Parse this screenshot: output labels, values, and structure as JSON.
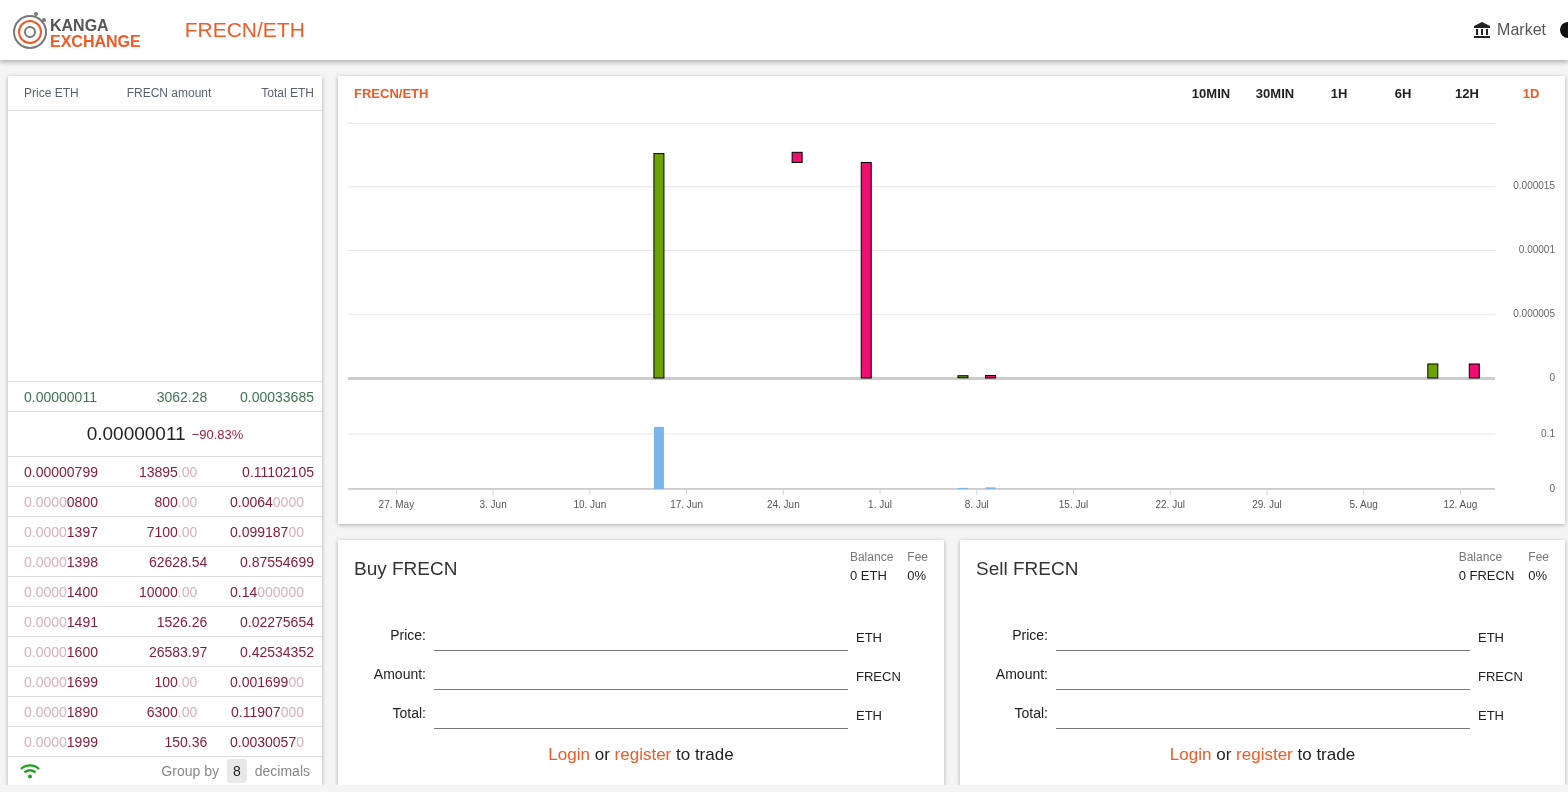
{
  "header": {
    "logo_top": "KANGA",
    "logo_bottom": "EXCHANGE",
    "pair": "FRECN/ETH",
    "market": "Market"
  },
  "order_book": {
    "columns": [
      "Price ETH",
      "FRECN amount",
      "Total ETH"
    ],
    "rows_above": [
      {
        "color": "#3d7550",
        "cells": [
          [
            {
              "text": "0.00000011",
              "faded": false
            }
          ],
          [
            {
              "text": "3062.28",
              "faded": false
            }
          ],
          [
            {
              "text": "0.00033685",
              "faded": false
            }
          ]
        ]
      }
    ],
    "last_price": "0.00000011",
    "change": "−90.83%",
    "rows_below": [
      {
        "color": "#8a1c3c",
        "cells": [
          [
            {
              "text": "0.00000799",
              "faded": false
            }
          ],
          [
            {
              "text": "13895",
              "faded": false
            },
            {
              "text": ".00",
              "faded": true
            }
          ],
          [
            {
              "text": "0.11102105",
              "faded": false
            }
          ]
        ]
      },
      {
        "color": "#8a1c3c",
        "cells": [
          [
            {
              "text": "0.0000",
              "faded": true
            },
            {
              "text": "0800",
              "faded": false
            }
          ],
          [
            {
              "text": "800",
              "faded": false
            },
            {
              "text": ".00",
              "faded": true
            }
          ],
          [
            {
              "text": "0.0064",
              "faded": false
            },
            {
              "text": "0000",
              "faded": true
            }
          ]
        ]
      },
      {
        "color": "#8a1c3c",
        "cells": [
          [
            {
              "text": "0.0000",
              "faded": true
            },
            {
              "text": "1397",
              "faded": false
            }
          ],
          [
            {
              "text": "7100",
              "faded": false
            },
            {
              "text": ".00",
              "faded": true
            }
          ],
          [
            {
              "text": "0.099187",
              "faded": false
            },
            {
              "text": "00",
              "faded": true
            }
          ]
        ]
      },
      {
        "color": "#8a1c3c",
        "cells": [
          [
            {
              "text": "0.0000",
              "faded": true
            },
            {
              "text": "1398",
              "faded": false
            }
          ],
          [
            {
              "text": "62628.54",
              "faded": false
            }
          ],
          [
            {
              "text": "0.87554699",
              "faded": false
            }
          ]
        ]
      },
      {
        "color": "#8a1c3c",
        "cells": [
          [
            {
              "text": "0.0000",
              "faded": true
            },
            {
              "text": "1400",
              "faded": false
            }
          ],
          [
            {
              "text": "10000",
              "faded": false
            },
            {
              "text": ".00",
              "faded": true
            }
          ],
          [
            {
              "text": "0.14",
              "faded": false
            },
            {
              "text": "000000",
              "faded": true
            }
          ]
        ]
      },
      {
        "color": "#8a1c3c",
        "cells": [
          [
            {
              "text": "0.0000",
              "faded": true
            },
            {
              "text": "1491",
              "faded": false
            }
          ],
          [
            {
              "text": "1526.26",
              "faded": false
            }
          ],
          [
            {
              "text": "0.02275654",
              "faded": false
            }
          ]
        ]
      },
      {
        "color": "#8a1c3c",
        "cells": [
          [
            {
              "text": "0.0000",
              "faded": true
            },
            {
              "text": "1600",
              "faded": false
            }
          ],
          [
            {
              "text": "26583.97",
              "faded": false
            }
          ],
          [
            {
              "text": "0.42534352",
              "faded": false
            }
          ]
        ]
      },
      {
        "color": "#8a1c3c",
        "cells": [
          [
            {
              "text": "0.0000",
              "faded": true
            },
            {
              "text": "1699",
              "faded": false
            }
          ],
          [
            {
              "text": "100",
              "faded": false
            },
            {
              "text": ".00",
              "faded": true
            }
          ],
          [
            {
              "text": "0.001699",
              "faded": false
            },
            {
              "text": "00",
              "faded": true
            }
          ]
        ]
      },
      {
        "color": "#8a1c3c",
        "cells": [
          [
            {
              "text": "0.0000",
              "faded": true
            },
            {
              "text": "1890",
              "faded": false
            }
          ],
          [
            {
              "text": "6300",
              "faded": false
            },
            {
              "text": ".00",
              "faded": true
            }
          ],
          [
            {
              "text": "0.11907",
              "faded": false
            },
            {
              "text": "000",
              "faded": true
            }
          ]
        ]
      },
      {
        "color": "#8a1c3c",
        "cells": [
          [
            {
              "text": "0.0000",
              "faded": true
            },
            {
              "text": "1999",
              "faded": false
            }
          ],
          [
            {
              "text": "150.36",
              "faded": false
            }
          ],
          [
            {
              "text": "0.0030057",
              "faded": false
            },
            {
              "text": "0",
              "faded": true
            }
          ]
        ]
      }
    ],
    "footer": {
      "connected": true,
      "group_by_label": "Group by",
      "decimals": "8",
      "decimals_label": "decimals"
    }
  },
  "chart": {
    "title": "FRECN/ETH",
    "intervals": [
      {
        "label": "10MIN",
        "selected": false
      },
      {
        "label": "30MIN",
        "selected": false
      },
      {
        "label": "1H",
        "selected": false
      },
      {
        "label": "6H",
        "selected": false
      },
      {
        "label": "12H",
        "selected": false
      },
      {
        "label": "1D",
        "selected": true
      }
    ],
    "price_panel": {
      "chart_data": {
        "type": "candlestick",
        "categories": [
          null,
          null,
          null,
          null,
          null,
          null,
          null,
          null,
          null,
          null,
          null,
          null,
          null,
          null,
          null,
          null,
          null,
          null,
          null,
          null,
          null,
          null,
          null,
          null,
          null,
          null,
          null,
          null,
          null,
          null,
          null,
          null,
          null,
          null,
          null,
          null,
          null,
          null,
          null,
          null,
          null,
          null,
          null,
          null,
          null,
          null,
          null,
          null,
          null,
          null,
          null,
          null,
          null,
          null,
          null,
          null,
          null,
          null,
          null,
          null,
          null,
          null,
          null,
          null,
          null,
          null,
          null,
          null,
          null,
          null,
          null,
          null,
          null,
          null,
          null,
          null,
          null,
          null,
          null,
          null,
          null,
          null,
          null
        ],
        "ylim": [
          0,
          2e-05
        ],
        "grid": true,
        "yticks": [
          {
            "value": 0,
            "label": "0"
          },
          {
            "value": 5e-06,
            "label": "0.000005"
          },
          {
            "value": 1e-05,
            "label": "0.00001"
          },
          {
            "value": 1.5e-05,
            "label": "0.000015"
          }
        ],
        "series": [
          {
            "color": "#6ca300",
            "ohlc": [
              null,
              null,
              null,
              null,
              null,
              null,
              null,
              null,
              null,
              null,
              null,
              null,
              null,
              null,
              null,
              null,
              null,
              null,
              null,
              null,
              null,
              null,
              [
                0,
                1.76e-05,
                0,
                1.76e-05
              ],
              null,
              null,
              null,
              null,
              null,
              null,
              null,
              null,
              null,
              null,
              null,
              null,
              null,
              null,
              null,
              null,
              null,
              null,
              null,
              null,
              null,
              [
                1e-07,
                1e-07,
                1e-07,
                1e-07
              ],
              null,
              null,
              null,
              null,
              null,
              null,
              null,
              null,
              null,
              null,
              null,
              null,
              null,
              null,
              null,
              null,
              null,
              null,
              null,
              null,
              null,
              null,
              null,
              null,
              null,
              null,
              null,
              null,
              null,
              null,
              null,
              null,
              null,
              [
                0,
                1.1e-06,
                0,
                1.1e-06
              ],
              null,
              null,
              null,
              null
            ]
          },
          {
            "color": "#ee0f6e",
            "ohlc": [
              null,
              null,
              null,
              null,
              null,
              null,
              null,
              null,
              null,
              null,
              null,
              null,
              null,
              null,
              null,
              null,
              null,
              null,
              null,
              null,
              null,
              null,
              null,
              null,
              null,
              null,
              null,
              null,
              null,
              null,
              null,
              null,
              [
                1.77e-05,
                1.77e-05,
                1.69e-05,
                1.69e-05
              ],
              null,
              null,
              null,
              null,
              [
                1.69e-05,
                1.69e-05,
                0,
                0
              ],
              null,
              null,
              null,
              null,
              null,
              null,
              null,
              null,
              [
                2e-07,
                2e-07,
                0,
                0
              ],
              null,
              null,
              null,
              null,
              null,
              null,
              null,
              null,
              null,
              null,
              null,
              null,
              null,
              null,
              null,
              null,
              null,
              null,
              null,
              null,
              null,
              null,
              null,
              null,
              null,
              null,
              null,
              null,
              null,
              null,
              null,
              null,
              null,
              null,
              [
                1.1e-06,
                1.1e-06,
                0,
                0
              ],
              null
            ]
          }
        ]
      }
    },
    "volume_panel": {
      "chart_data": {
        "type": "bar",
        "categories": [
          null,
          null,
          null,
          "27. May",
          null,
          null,
          null,
          null,
          null,
          null,
          "3. Jun",
          null,
          null,
          null,
          null,
          null,
          null,
          "10. Jun",
          null,
          null,
          null,
          null,
          null,
          null,
          "17. Jun",
          null,
          null,
          null,
          null,
          null,
          null,
          "24. Jun",
          null,
          null,
          null,
          null,
          null,
          null,
          "1. Jul",
          null,
          null,
          null,
          null,
          null,
          null,
          "8. Jul",
          null,
          null,
          null,
          null,
          null,
          null,
          "15. Jul",
          null,
          null,
          null,
          null,
          null,
          null,
          "22. Jul",
          null,
          null,
          null,
          null,
          null,
          null,
          "29. Jul",
          null,
          null,
          null,
          null,
          null,
          null,
          "5. Aug",
          null,
          null,
          null,
          null,
          null,
          null,
          "12. Aug",
          null,
          null
        ],
        "ylim": [
          0,
          0.2
        ],
        "grid": true,
        "yticks": [
          {
            "value": 0,
            "label": "0"
          },
          {
            "value": 0.1,
            "label": "0.1"
          }
        ],
        "series": [
          {
            "color": "#7cb5ec",
            "values": [
              null,
              null,
              null,
              null,
              null,
              null,
              null,
              null,
              null,
              null,
              null,
              null,
              null,
              null,
              null,
              null,
              null,
              null,
              null,
              null,
              null,
              null,
              0.113,
              null,
              null,
              null,
              null,
              null,
              null,
              null,
              null,
              null,
              null,
              null,
              null,
              null,
              null,
              null,
              null,
              null,
              null,
              null,
              null,
              null,
              0.002,
              null,
              0.003,
              null,
              null,
              null,
              null,
              null,
              null,
              null,
              null,
              null,
              null,
              null,
              null,
              null,
              null,
              null,
              null,
              null,
              null,
              null,
              null,
              null,
              null,
              null,
              null,
              null,
              null,
              null,
              null,
              null,
              null,
              null,
              null,
              null,
              null,
              null,
              null
            ]
          }
        ]
      }
    }
  },
  "trade_forms": [
    {
      "title": "Buy FRECN",
      "balance_label": "Balance",
      "balance": "0 ETH",
      "fee_label": "Fee",
      "fee": "0%",
      "fields": [
        {
          "label": "Price:",
          "unit": "ETH"
        },
        {
          "label": "Amount:",
          "unit": "FRECN"
        },
        {
          "label": "Total:",
          "unit": "ETH"
        }
      ],
      "prompt": [
        {
          "kind": "link",
          "text": "Login"
        },
        {
          "kind": "text",
          "text": "or"
        },
        {
          "kind": "link",
          "text": "register"
        },
        {
          "kind": "text",
          "text": "to trade"
        }
      ]
    },
    {
      "title": "Sell FRECN",
      "balance_label": "Balance",
      "balance": "0 FRECN",
      "fee_label": "Fee",
      "fee": "0%",
      "fields": [
        {
          "label": "Price:",
          "unit": "ETH"
        },
        {
          "label": "Amount:",
          "unit": "FRECN"
        },
        {
          "label": "Total:",
          "unit": "ETH"
        }
      ],
      "prompt": [
        {
          "kind": "link",
          "text": "Login"
        },
        {
          "kind": "text",
          "text": "or"
        },
        {
          "kind": "link",
          "text": "register"
        },
        {
          "kind": "text",
          "text": "to trade"
        }
      ]
    }
  ]
}
